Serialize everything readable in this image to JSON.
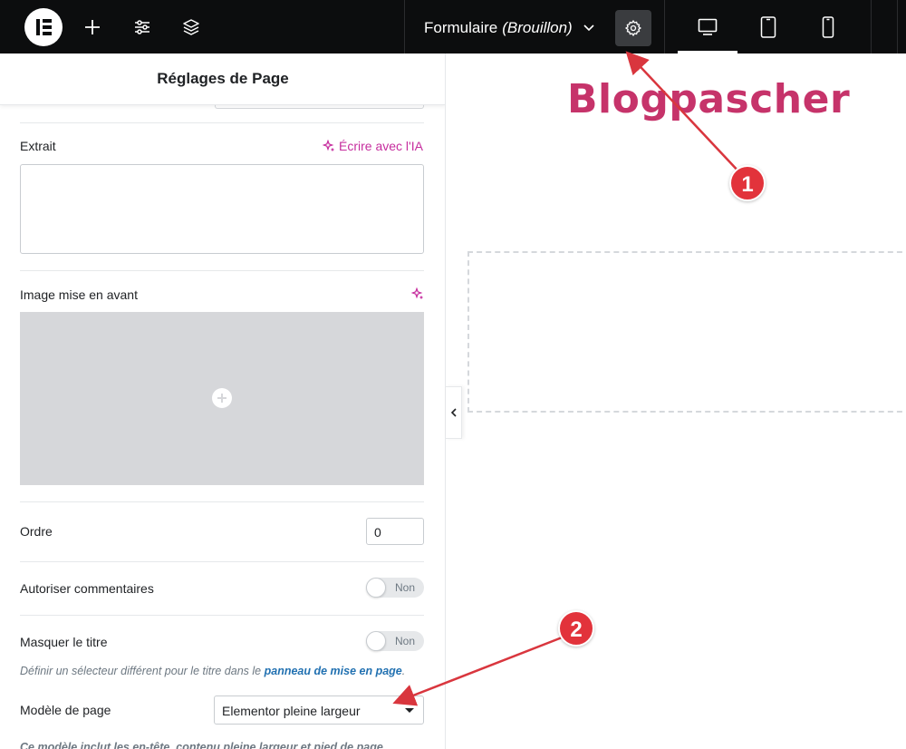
{
  "topbar": {
    "doc_title": "Formulaire",
    "doc_status": "(Brouillon)",
    "icons": [
      "elementor-logo-icon",
      "add-icon",
      "settings-sliders-icon",
      "layers-icon",
      "chevron-down-icon",
      "gear-icon",
      "desktop-icon",
      "tablet-icon",
      "mobile-icon"
    ]
  },
  "panel": {
    "title": "Réglages de Page",
    "excerpt": {
      "label": "Extrait",
      "ai_label": "Écrire avec l'IA",
      "value": ""
    },
    "featured_image": {
      "label": "Image mise en avant"
    },
    "order": {
      "label": "Ordre",
      "value": "0"
    },
    "comments": {
      "label": "Autoriser commentaires",
      "toggle": "Non"
    },
    "hide_title": {
      "label": "Masquer le titre",
      "toggle": "Non",
      "help_prefix": "Définir un sélecteur différent pour le titre dans le",
      "help_link": "panneau de mise en page",
      "help_suffix": "."
    },
    "template": {
      "label": "Modèle de page",
      "value": "Elementor pleine largeur",
      "help": "Ce modèle inclut les en-tête, contenu pleine largeur et pied de page"
    }
  },
  "canvas": {
    "watermark": "Blogpascher"
  },
  "annotations": [
    {
      "label": "1",
      "color": "#e2333b"
    },
    {
      "label": "2",
      "color": "#e2333b"
    }
  ]
}
